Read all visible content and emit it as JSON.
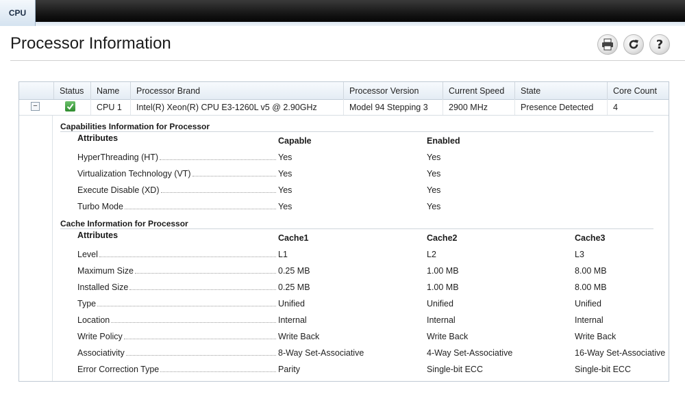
{
  "tab": {
    "label": "CPU"
  },
  "page": {
    "title": "Processor Information"
  },
  "toolbar": {
    "print_icon": "printer-icon",
    "refresh_icon": "refresh-icon",
    "help_icon": "help-icon"
  },
  "table": {
    "headers": [
      "Status",
      "Name",
      "Processor Brand",
      "Processor Version",
      "Current Speed",
      "State",
      "Core Count"
    ],
    "row": {
      "status_icon": "check-icon",
      "name": "CPU 1",
      "brand": "Intel(R) Xeon(R) CPU E3-1260L v5 @ 2.90GHz",
      "version": "Model 94 Stepping 3",
      "speed": "2900 MHz",
      "state": "Presence Detected",
      "cores": "4"
    }
  },
  "capabilities": {
    "title": "Capabilities Information for Processor",
    "attr_header": "Attributes",
    "col1": "Capable",
    "col2": "Enabled",
    "rows": [
      {
        "label": "HyperThreading (HT)",
        "capable": "Yes",
        "enabled": "Yes"
      },
      {
        "label": "Virtualization Technology (VT)",
        "capable": "Yes",
        "enabled": "Yes"
      },
      {
        "label": "Execute Disable (XD)",
        "capable": "Yes",
        "enabled": "Yes"
      },
      {
        "label": "Turbo Mode",
        "capable": "Yes",
        "enabled": "Yes"
      }
    ]
  },
  "cache": {
    "title": "Cache Information for Processor",
    "attr_header": "Attributes",
    "cols": [
      "Cache1",
      "Cache2",
      "Cache3"
    ],
    "rows": [
      {
        "label": "Level",
        "v": [
          "L1",
          "L2",
          "L3"
        ]
      },
      {
        "label": "Maximum Size",
        "v": [
          "0.25 MB",
          "1.00 MB",
          "8.00 MB"
        ]
      },
      {
        "label": "Installed Size",
        "v": [
          "0.25 MB",
          "1.00 MB",
          "8.00 MB"
        ]
      },
      {
        "label": "Type",
        "v": [
          "Unified",
          "Unified",
          "Unified"
        ]
      },
      {
        "label": "Location",
        "v": [
          "Internal",
          "Internal",
          "Internal"
        ]
      },
      {
        "label": "Write Policy",
        "v": [
          "Write Back",
          "Write Back",
          "Write Back"
        ]
      },
      {
        "label": "Associativity",
        "v": [
          "8-Way Set-Associative",
          "4-Way Set-Associative",
          "16-Way Set-Associative"
        ]
      },
      {
        "label": "Error Correction Type",
        "v": [
          "Parity",
          "Single-bit ECC",
          "Single-bit ECC"
        ]
      }
    ]
  }
}
